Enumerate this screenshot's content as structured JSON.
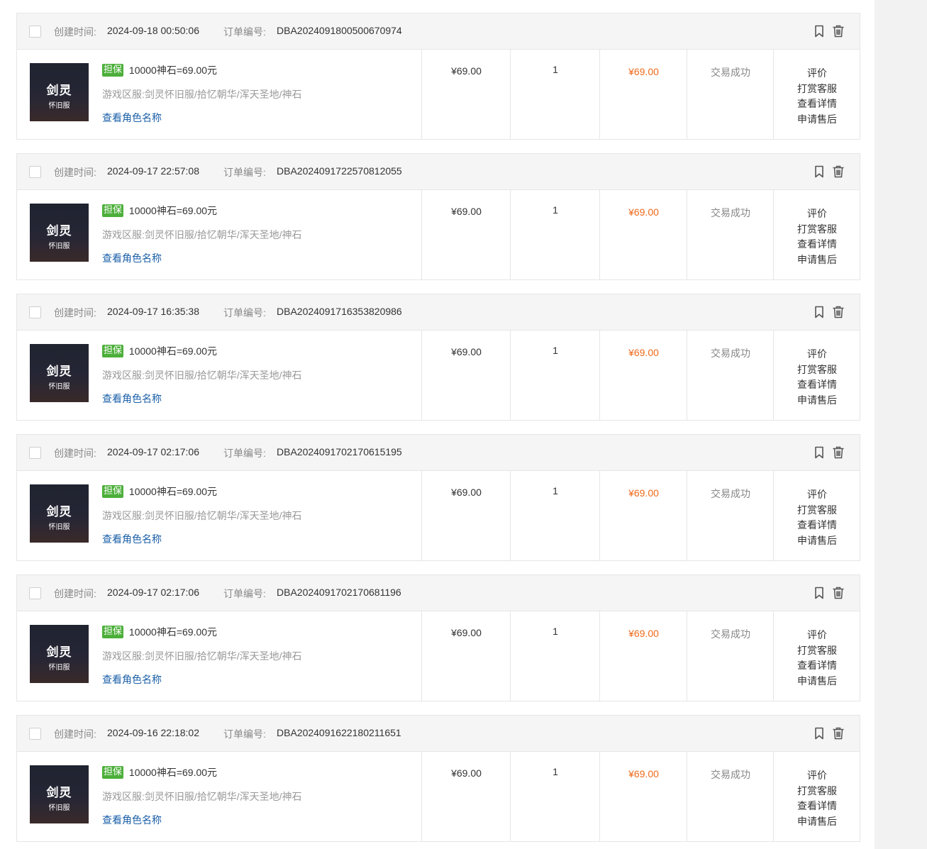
{
  "labels": {
    "created_time": "创建时间:",
    "order_no": "订单编号:",
    "badge": "担保",
    "server_label": "游戏区服:",
    "view_role": "查看角色名称",
    "thumb_title": "剑灵",
    "thumb_sub": "怀旧服"
  },
  "actions": [
    "评价",
    "打赏客服",
    "查看详情",
    "申请售后"
  ],
  "icons": {
    "bookmark": "bookmark-icon",
    "delete": "trash-icon"
  },
  "colors": {
    "badge": "#4caf3a",
    "paid": "#ef6a1b",
    "link": "#1a5fa8"
  },
  "orders": [
    {
      "created": "2024-09-18 00:50:06",
      "order_no": "DBA2024091800500670974",
      "goods": "10000神石=69.00元",
      "server": "剑灵怀旧服/拾忆朝华/浑天圣地/神石",
      "price": "¥69.00",
      "qty": "1",
      "paid": "¥69.00",
      "status": "交易成功"
    },
    {
      "created": "2024-09-17 22:57:08",
      "order_no": "DBA2024091722570812055",
      "goods": "10000神石=69.00元",
      "server": "剑灵怀旧服/拾忆朝华/浑天圣地/神石",
      "price": "¥69.00",
      "qty": "1",
      "paid": "¥69.00",
      "status": "交易成功"
    },
    {
      "created": "2024-09-17 16:35:38",
      "order_no": "DBA2024091716353820986",
      "goods": "10000神石=69.00元",
      "server": "剑灵怀旧服/拾忆朝华/浑天圣地/神石",
      "price": "¥69.00",
      "qty": "1",
      "paid": "¥69.00",
      "status": "交易成功"
    },
    {
      "created": "2024-09-17 02:17:06",
      "order_no": "DBA2024091702170615195",
      "goods": "10000神石=69.00元",
      "server": "剑灵怀旧服/拾忆朝华/浑天圣地/神石",
      "price": "¥69.00",
      "qty": "1",
      "paid": "¥69.00",
      "status": "交易成功"
    },
    {
      "created": "2024-09-17 02:17:06",
      "order_no": "DBA2024091702170681196",
      "goods": "10000神石=69.00元",
      "server": "剑灵怀旧服/拾忆朝华/浑天圣地/神石",
      "price": "¥69.00",
      "qty": "1",
      "paid": "¥69.00",
      "status": "交易成功"
    },
    {
      "created": "2024-09-16 22:18:02",
      "order_no": "DBA2024091622180211651",
      "goods": "10000神石=69.00元",
      "server": "剑灵怀旧服/拾忆朝华/浑天圣地/神石",
      "price": "¥69.00",
      "qty": "1",
      "paid": "¥69.00",
      "status": "交易成功"
    }
  ]
}
